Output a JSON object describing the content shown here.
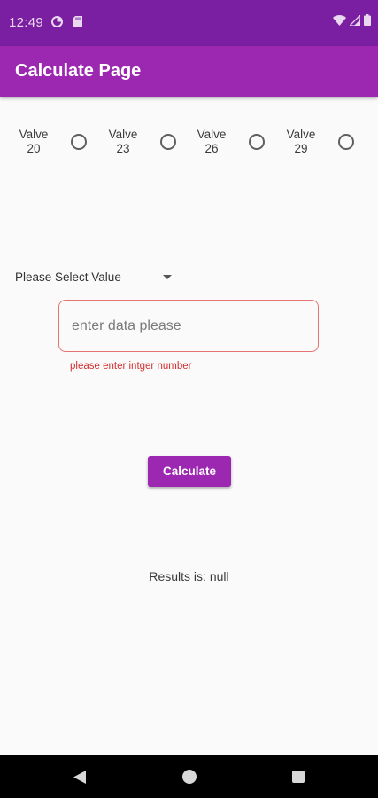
{
  "status_bar": {
    "time": "12:49",
    "left_icons": [
      "data-saver-icon",
      "sd-card-icon"
    ],
    "right_icons": [
      "wifi-icon",
      "signal-icon",
      "battery-icon"
    ],
    "background": "#7b1fa2"
  },
  "app_bar": {
    "title": "Calculate Page",
    "background": "#9c27b0"
  },
  "valves": [
    {
      "label_top": "Valve",
      "label_bottom": "20",
      "selected": false
    },
    {
      "label_top": "Valve",
      "label_bottom": "23",
      "selected": false
    },
    {
      "label_top": "Valve",
      "label_bottom": "26",
      "selected": false
    },
    {
      "label_top": "Valve",
      "label_bottom": "29",
      "selected": false
    }
  ],
  "dropdown": {
    "label": "Please Select Value",
    "icon": "arrow-drop-down-icon"
  },
  "input": {
    "value": "",
    "placeholder": "enter data please",
    "error": "please enter intger number"
  },
  "button": {
    "label": "Calculate"
  },
  "result": {
    "text": "Results is: null"
  },
  "nav_bar": {
    "icons": [
      "back-icon",
      "home-icon",
      "recents-icon"
    ]
  },
  "colors": {
    "primary": "#9c27b0",
    "primary_dark": "#7b1fa2",
    "error": "#d32f2f",
    "background": "#fafafa"
  }
}
